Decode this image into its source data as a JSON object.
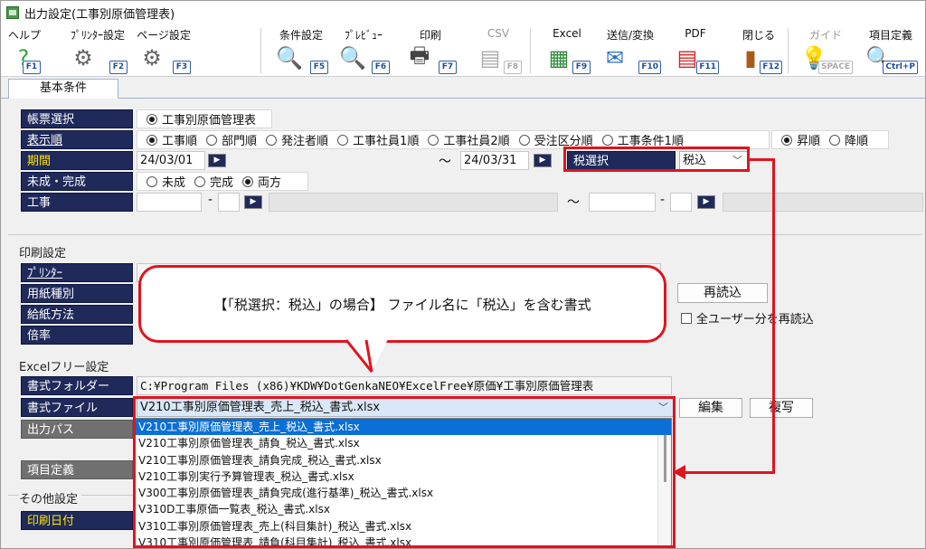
{
  "window": {
    "title": "出力設定(工事別原価管理表)"
  },
  "toolbar": [
    {
      "label": "ヘルプ",
      "key": "F1",
      "icon": "help-icon",
      "glyph": "?",
      "color": "#3aa23a"
    },
    {
      "label": "ﾌﾟﾘﾝﾀｰ設定",
      "key": "F2",
      "icon": "printer-settings-icon",
      "glyph": "⚙",
      "color": "#666"
    },
    {
      "label": "ページ設定",
      "key": "F3",
      "icon": "page-settings-icon",
      "glyph": "⚙",
      "color": "#666"
    },
    {
      "label": "条件設定",
      "key": "F5",
      "icon": "search-icon",
      "glyph": "🔍",
      "color": "#555"
    },
    {
      "label": "ﾌﾟﾚﾋﾞｭｰ",
      "key": "F6",
      "icon": "preview-icon",
      "glyph": "🔍",
      "color": "#555"
    },
    {
      "label": "印刷",
      "key": "F7",
      "icon": "print-icon",
      "glyph": "🖶",
      "color": "#444"
    },
    {
      "label": "CSV",
      "key": "F8",
      "icon": "csv-icon",
      "glyph": "▤",
      "color": "#aaa",
      "disabled": true
    },
    {
      "label": "Excel",
      "key": "F9",
      "icon": "excel-icon",
      "glyph": "▦",
      "color": "#2e8b3a"
    },
    {
      "label": "送信/変換",
      "key": "F10",
      "icon": "mail-icon",
      "glyph": "✉",
      "color": "#2a72c8"
    },
    {
      "label": "PDF",
      "key": "F11",
      "icon": "pdf-icon",
      "glyph": "▤",
      "color": "#d22"
    },
    {
      "label": "閉じる",
      "key": "F12",
      "icon": "close-door-icon",
      "glyph": "▮",
      "color": "#a85a1a"
    },
    {
      "label": "ガイド",
      "key": "SPACE",
      "icon": "guide-bulb-icon",
      "glyph": "💡",
      "color": "#bbb",
      "disabled": true
    },
    {
      "label": "項目定義",
      "key": "Ctrl+P",
      "icon": "item-definition-icon",
      "glyph": "🔍",
      "color": "#555"
    }
  ],
  "tab": {
    "label": "基本条件"
  },
  "fields": {
    "report_select": {
      "label": "帳票選択",
      "options": [
        {
          "text": "工事別原価管理表",
          "checked": true
        }
      ]
    },
    "display_order": {
      "label": "表示順",
      "options": [
        {
          "text": "工事順",
          "checked": true
        },
        {
          "text": "部門順",
          "checked": false
        },
        {
          "text": "発注者順",
          "checked": false
        },
        {
          "text": "工事社員1順",
          "checked": false
        },
        {
          "text": "工事社員2順",
          "checked": false
        },
        {
          "text": "受注区分順",
          "checked": false
        },
        {
          "text": "工事条件1順",
          "checked": false
        }
      ],
      "sort": [
        {
          "text": "昇順",
          "checked": true
        },
        {
          "text": "降順",
          "checked": false
        }
      ]
    },
    "period": {
      "label": "期間",
      "from": "24/03/01",
      "tilde": "～",
      "to": "24/03/31"
    },
    "tax": {
      "label": "税選択",
      "value": "税込"
    },
    "completion": {
      "label": "未成・完成",
      "options": [
        {
          "text": "未成",
          "checked": false
        },
        {
          "text": "完成",
          "checked": false
        },
        {
          "text": "両方",
          "checked": true
        }
      ]
    },
    "construction": {
      "label": "工事",
      "dash": "-",
      "tilde": "～"
    }
  },
  "print_settings": {
    "section": "印刷設定",
    "labels": [
      "ﾌﾟﾘﾝﾀｰ",
      "用紙種別",
      "給紙方法",
      "倍率"
    ],
    "reload_button": "再読込",
    "all_users_checkbox": "全ユーザー分を再読込"
  },
  "excel_free": {
    "section": "Excelフリー設定",
    "folder_label": "書式フォルダー",
    "folder_value": "C:¥Program Files (x86)¥KDW¥DotGenkaNEO¥ExcelFree¥原価¥工事別原価管理表",
    "file_label": "書式ファイル",
    "file_value": "V210工事別原価管理表_売上_税込_書式.xlsx",
    "edit_button": "編集",
    "copy_button": "複写",
    "output_path_label": "出力パス",
    "item_def_label": "項目定義",
    "file_options": [
      "V210工事別原価管理表_売上_税込_書式.xlsx",
      "V210工事別原価管理表_請負_税込_書式.xlsx",
      "V210工事別原価管理表_請負完成_税込_書式.xlsx",
      "V210工事別実行予算管理表_税込_書式.xlsx",
      "V300工事別原価管理表_請負完成(進行基準)_税込_書式.xlsx",
      "V310D工事原価一覧表_税込_書式.xlsx",
      "V310工事別原価管理表_売上(科目集計)_税込_書式.xlsx",
      "V310工事別原価管理表_請負(科目集計)_税込_書式.xlsx"
    ]
  },
  "other_settings": {
    "section": "その他設定",
    "print_date_label": "印刷日付"
  },
  "callout": {
    "text": "【「税選択：税込」の場合】 ファイル名に「税込」を含む書式"
  },
  "colors": {
    "label_bg": "#1f2a5a",
    "annotation_red": "#e0141e",
    "selection_blue": "#0a6fd6"
  }
}
